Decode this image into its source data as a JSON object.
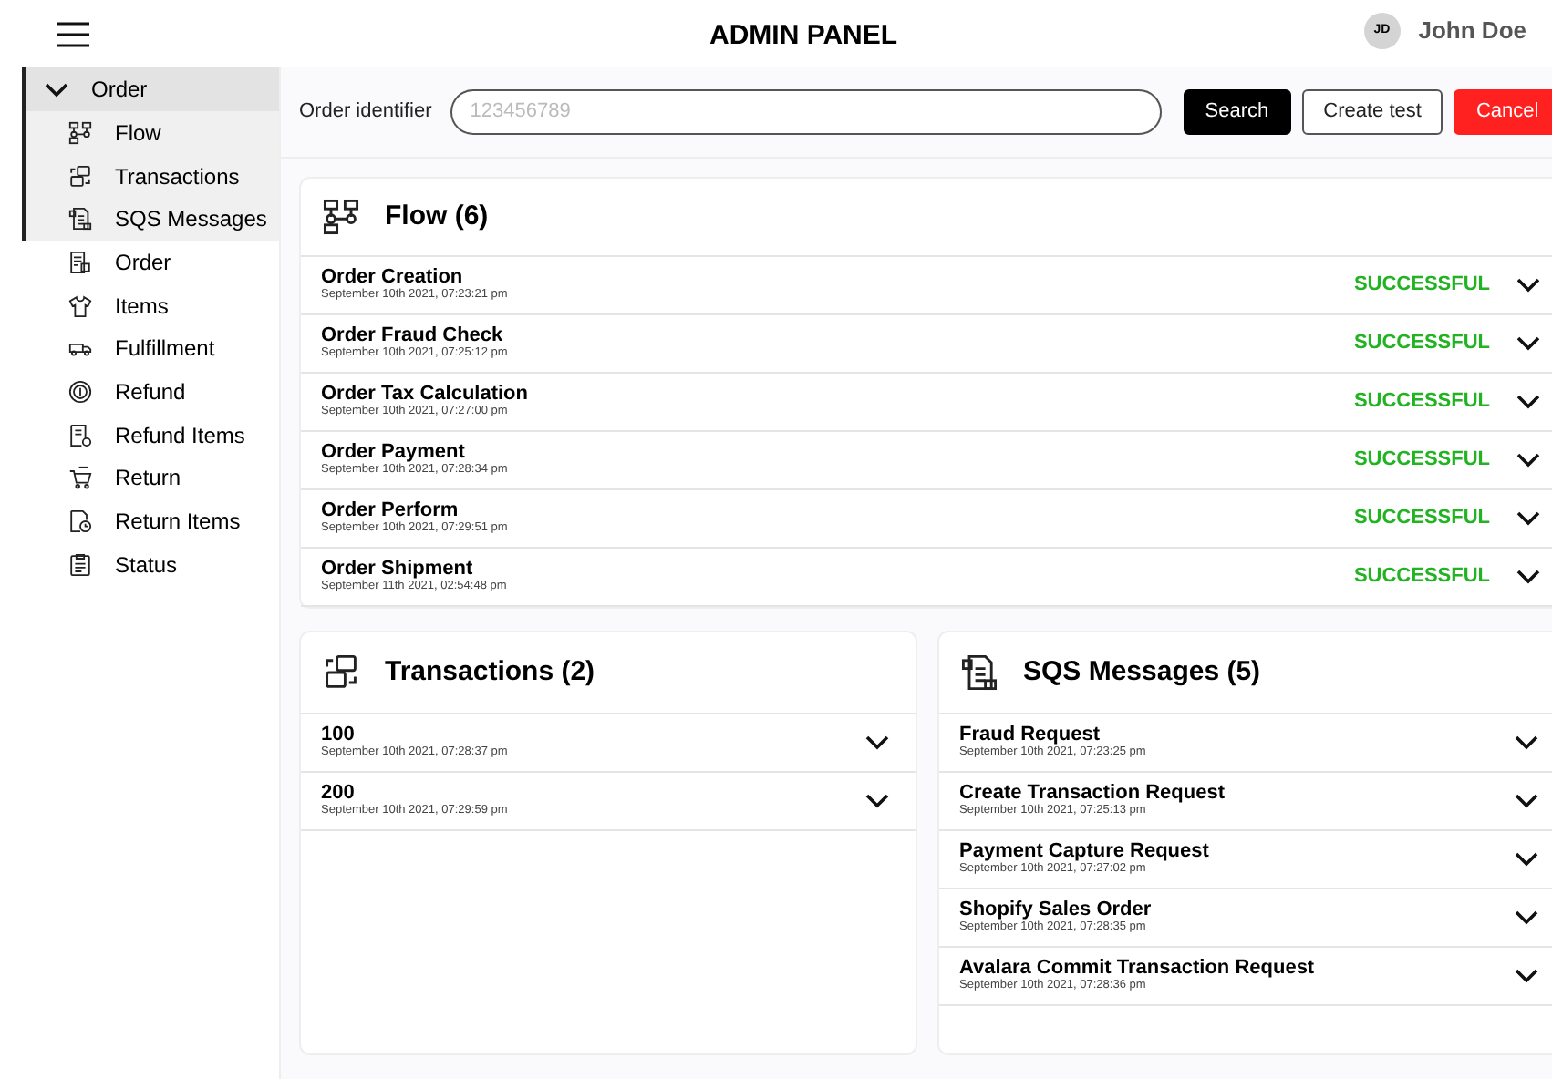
{
  "header": {
    "title": "ADMIN PANEL",
    "user": {
      "initials": "JD",
      "name": "John Doe"
    }
  },
  "sidebar": {
    "groups": [
      {
        "label": "Order",
        "expanded": true,
        "children": [
          {
            "label": "Flow"
          },
          {
            "label": "Transactions"
          },
          {
            "label": "SQS Messages"
          }
        ]
      }
    ],
    "items": [
      {
        "label": "Order"
      },
      {
        "label": "Items"
      },
      {
        "label": "Fulfillment"
      },
      {
        "label": "Refund"
      },
      {
        "label": "Refund Items"
      },
      {
        "label": "Return"
      },
      {
        "label": "Return Items"
      },
      {
        "label": "Status"
      }
    ]
  },
  "search": {
    "label": "Order identifier",
    "placeholder": "123456789",
    "buttons": [
      {
        "label": "Search",
        "kind": "primary"
      },
      {
        "label": "Create test",
        "kind": "outline"
      },
      {
        "label": "Cancel",
        "kind": "danger"
      }
    ]
  },
  "flow": {
    "title": "Flow (6)",
    "rows": [
      {
        "name": "Order Creation",
        "time": "September 10th 2021, 07:23:21 pm",
        "status": "SUCCESSFUL"
      },
      {
        "name": "Order Fraud Check",
        "time": "September 10th 2021, 07:25:12 pm",
        "status": "SUCCESSFUL"
      },
      {
        "name": "Order Tax Calculation",
        "time": "September 10th 2021, 07:27:00 pm",
        "status": "SUCCESSFUL"
      },
      {
        "name": "Order Payment",
        "time": "September 10th 2021, 07:28:34 pm",
        "status": "SUCCESSFUL"
      },
      {
        "name": "Order Perform",
        "time": "September 10th 2021, 07:29:51 pm",
        "status": "SUCCESSFUL"
      },
      {
        "name": "Order Shipment",
        "time": "September 11th 2021, 02:54:48 pm",
        "status": "SUCCESSFUL"
      }
    ]
  },
  "transactions": {
    "title": "Transactions (2)",
    "rows": [
      {
        "name": "100",
        "time": "September 10th 2021, 07:28:37 pm"
      },
      {
        "name": "200",
        "time": "September 10th 2021, 07:29:59 pm"
      }
    ]
  },
  "sqs_messages": {
    "title": "SQS Messages (5)",
    "rows": [
      {
        "name": "Fraud Request",
        "time": "September 10th 2021, 07:23:25 pm"
      },
      {
        "name": "Create Transaction Request",
        "time": "September 10th 2021, 07:25:13 pm"
      },
      {
        "name": "Payment Capture Request",
        "time": "September 10th 2021, 07:27:02 pm"
      },
      {
        "name": "Shopify Sales Order",
        "time": "September 10th 2021, 07:28:35 pm"
      },
      {
        "name": "Avalara Commit Transaction Request",
        "time": "September 10th 2021, 07:28:36 pm"
      }
    ]
  }
}
